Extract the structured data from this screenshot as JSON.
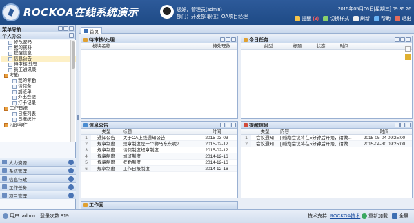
{
  "header": {
    "app_title": "ROCKOA在线系统演示",
    "user_line": "您好，管理员(admin)",
    "dept_line": "部门：开发部  职位：OA项目经理",
    "datetime": "2015年05月06日[星期三] 09:35:26",
    "toolbar": [
      {
        "label": "提醒",
        "badge": "(3)",
        "color": "#f6c44a"
      },
      {
        "label": "切换样式",
        "badge": "",
        "color": "#8ad06b"
      },
      {
        "label": "刷新",
        "badge": "",
        "color": "#f0f0f0"
      },
      {
        "label": "帮助",
        "badge": "",
        "color": "#69b4f5"
      },
      {
        "label": "退出",
        "badge": "",
        "color": "#e36c5c"
      }
    ]
  },
  "sidebar": {
    "title": "菜单导航",
    "group_open": "个人办公",
    "tree": [
      {
        "label": "修改密码",
        "indent": 1,
        "selected": false
      },
      {
        "label": "我的资料",
        "indent": 1,
        "selected": false
      },
      {
        "label": "提醒信息",
        "indent": 1,
        "selected": false
      },
      {
        "label": "信息公告",
        "indent": 1,
        "selected": true
      },
      {
        "label": "待审核/处理",
        "indent": 1,
        "selected": false
      },
      {
        "label": "员工通讯录",
        "indent": 1,
        "selected": false
      },
      {
        "label": "考勤",
        "indent": 0,
        "selected": false
      },
      {
        "label": "我的考勤",
        "indent": 2,
        "selected": false
      },
      {
        "label": "请假条",
        "indent": 2,
        "selected": false
      },
      {
        "label": "加班单",
        "indent": 2,
        "selected": false
      },
      {
        "label": "外出登记",
        "indent": 2,
        "selected": false
      },
      {
        "label": "打卡记录",
        "indent": 2,
        "selected": false
      },
      {
        "label": "工作日报",
        "indent": 0,
        "selected": false
      },
      {
        "label": "日报列表",
        "indent": 2,
        "selected": false
      },
      {
        "label": "日报统计",
        "indent": 2,
        "selected": false
      },
      {
        "label": "内部邮件",
        "indent": 0,
        "selected": false
      }
    ],
    "groups": [
      "人力资源",
      "系统管理",
      "信息行政",
      "工作任务",
      "项目管理"
    ]
  },
  "tabs": [
    "首页"
  ],
  "panels": {
    "todo": {
      "title": "待审核/处理",
      "columns": [
        "模块名称",
        "待处理数"
      ],
      "rows": []
    },
    "today": {
      "title": "今日任务",
      "columns": [
        "类型",
        "标题",
        "状态",
        "时间"
      ],
      "rows": []
    },
    "notice": {
      "title": "信息公告",
      "columns": [
        "类型",
        "标题",
        "时间"
      ],
      "rows": [
        [
          "1",
          "通知公告",
          "关于OA上线通知公告",
          "2015-03-03"
        ],
        [
          "2",
          "规章制度",
          "规章制度是一个狮马东东呢?",
          "2015-02-12"
        ],
        [
          "3",
          "规章制度",
          "请假制度规章制度",
          "2015-02-12"
        ],
        [
          "4",
          "规章制度",
          "加班制度",
          "2014-12-16"
        ],
        [
          "5",
          "规章制度",
          "考勤制度",
          "2014-12-16"
        ],
        [
          "6",
          "规章制度",
          "工作日报制度",
          "2014-12-16"
        ]
      ]
    },
    "remind": {
      "title": "提醒信息",
      "columns": [
        "类型",
        "内容",
        "时间"
      ],
      "rows": [
        [
          "1",
          "会议通知",
          "[测试]会议将在5分钟后开始，请做...",
          "2015-05-04 09:25:00"
        ],
        [
          "2",
          "会议通知",
          "[测试]会议将在5分钟后开始，请做...",
          "2015-04-30 09:25:00"
        ]
      ]
    },
    "fourth": {
      "title": "工作面"
    }
  },
  "status": {
    "user": "用户: admin",
    "logins": "登录次数:819",
    "support_label": "技术支持:",
    "support_link": "ROCKOA技术",
    "reload": "重新加载",
    "fullscreen": "全屏"
  }
}
